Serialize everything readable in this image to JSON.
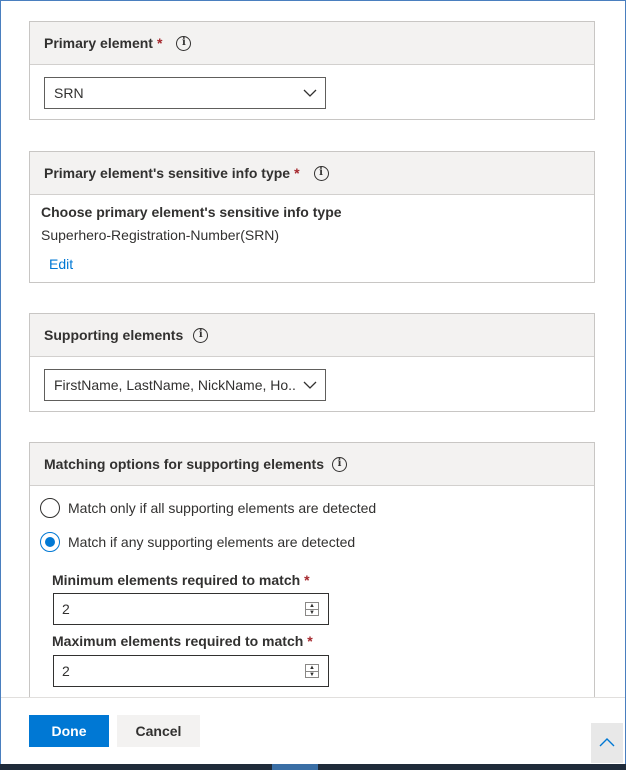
{
  "primary_element": {
    "header": "Primary element",
    "required": "*",
    "dropdown_value": "SRN"
  },
  "sensitive_info_type": {
    "header": "Primary element's sensitive info type",
    "required": "*",
    "choose_title": "Choose primary element's sensitive info type",
    "selected_value": "Superhero-Registration-Number(SRN)",
    "edit_link": "Edit"
  },
  "supporting_elements": {
    "header": "Supporting elements",
    "dropdown_value": "FirstName, LastName, NickName, Ho..."
  },
  "matching_options": {
    "header": "Matching options for supporting elements",
    "option_all": "Match only if all supporting elements are detected",
    "option_any": "Match if any supporting elements are detected",
    "selected": "option_any",
    "min_label": "Minimum elements required to match",
    "min_value": "2",
    "max_label": "Maximum elements required to match",
    "max_value": "2",
    "required": "*"
  },
  "footer": {
    "done_label": "Done",
    "cancel_label": "Cancel"
  },
  "icons": {
    "info": "info-icon",
    "chevron": "chevron-down-icon",
    "scroll_top": "chevron-up-icon"
  },
  "colors": {
    "accent": "#0078d4",
    "required": "#a4262c",
    "header_bg": "#f3f2f1"
  }
}
